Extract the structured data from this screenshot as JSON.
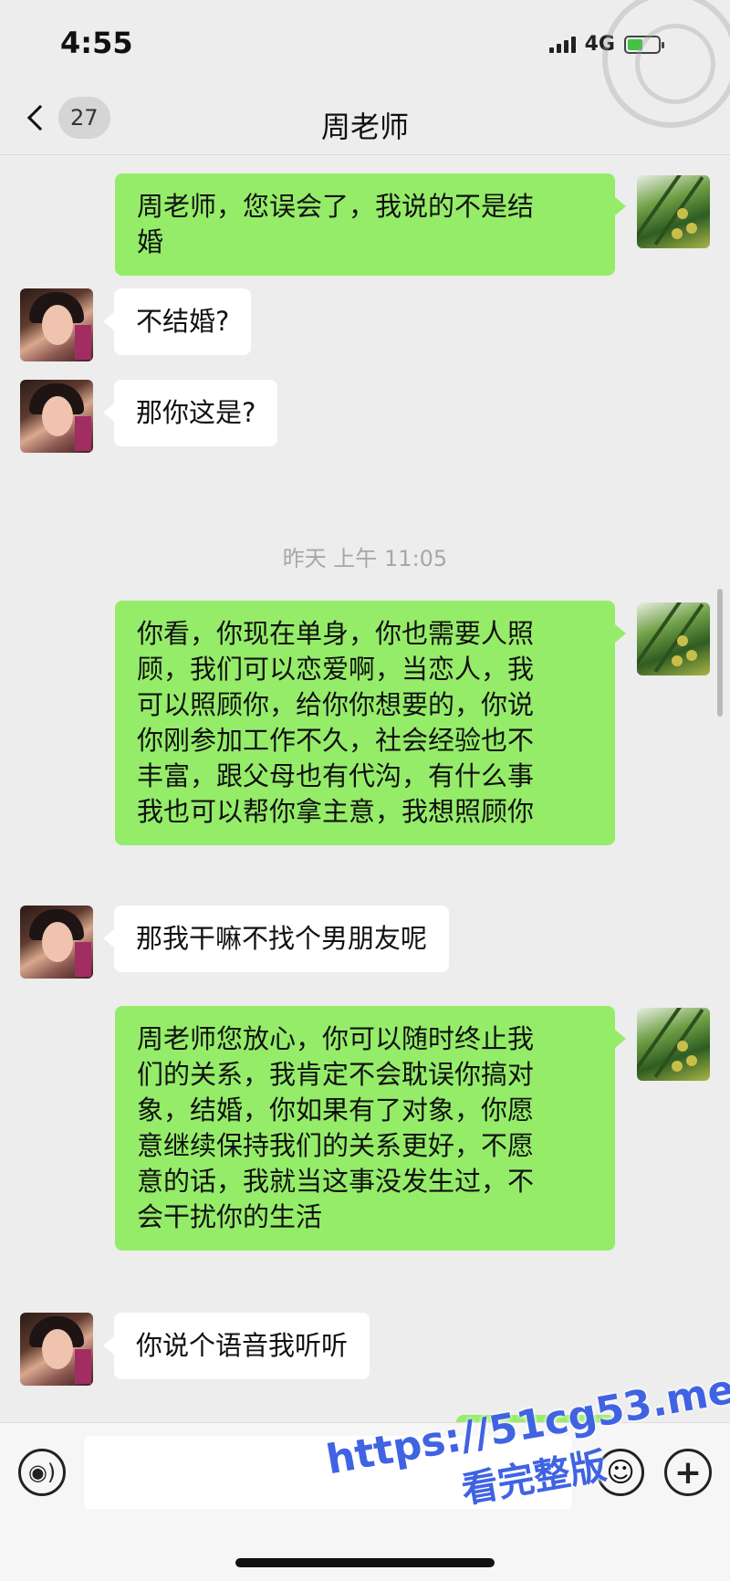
{
  "status_bar": {
    "time": "4:55",
    "network": "4G",
    "battery_level": 0.5
  },
  "header": {
    "back_badge": "27",
    "title": "周老师"
  },
  "messages": [
    {
      "side": "right",
      "avatar": "rice-field-avatar",
      "text": "周老师，您误会了，我说的不是结\n婚"
    },
    {
      "side": "left",
      "avatar": "woman-avatar",
      "text": "不结婚?"
    },
    {
      "side": "left",
      "avatar": "woman-avatar",
      "text": "那你这是?"
    },
    {
      "type": "timestamp",
      "text": "昨天 上午 11:05"
    },
    {
      "side": "right",
      "avatar": "rice-field-avatar",
      "text": "你看，你现在单身，你也需要人照\n顾，我们可以恋爱啊，当恋人，我\n可以照顾你，给你你想要的，你说\n你刚参加工作不久，社会经验也不\n丰富，跟父母也有代沟，有什么事\n我也可以帮你拿主意，我想照顾你"
    },
    {
      "side": "left",
      "avatar": "woman-avatar",
      "text": "那我干嘛不找个男朋友呢"
    },
    {
      "side": "right",
      "avatar": "rice-field-avatar",
      "text": "周老师您放心，你可以随时终止我\n们的关系，我肯定不会耽误你搞对\n象，结婚，你如果有了对象，你愿\n意继续保持我们的关系更好，不愿\n意的话，我就当这事没发生过，不\n会干扰你的生活"
    },
    {
      "side": "left",
      "avatar": "woman-avatar",
      "text": "你说个语音我听听"
    }
  ],
  "input_bar": {
    "text_value": "",
    "voice_icon": "voice-icon",
    "emoji_icon": "emoji-icon",
    "plus_icon": "plus-icon"
  },
  "watermark": {
    "url": "https://51cg53.me",
    "text": "看完整版"
  },
  "colors": {
    "background": "#ededed",
    "sent_bubble": "#95ec69",
    "received_bubble": "#ffffff",
    "watermark": "#3f63e3"
  }
}
